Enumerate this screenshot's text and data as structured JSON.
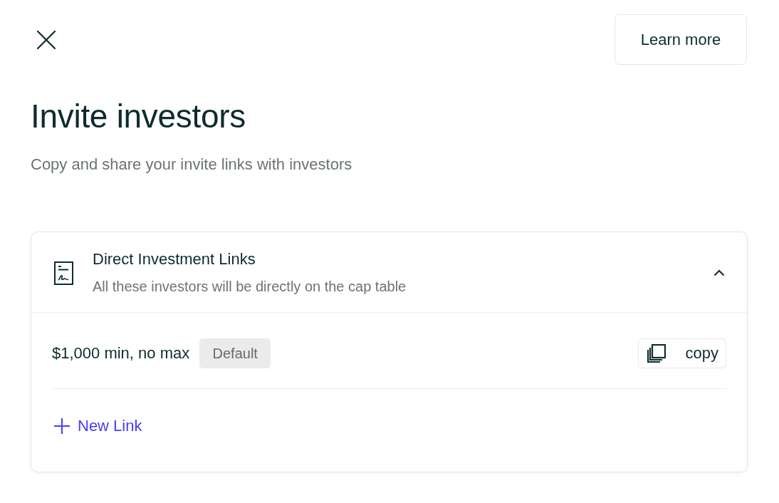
{
  "learn_more_button": "Learn more",
  "title": "Invite investors",
  "subtitle": "Copy and share your invite links with investors",
  "section": {
    "title": "Direct Investment Links",
    "description": "All these investors will be directly on the cap table",
    "expanded": true,
    "links": [
      {
        "label": "$1,000 min, no max",
        "badge": "Default",
        "copy_button": "copy"
      }
    ],
    "new_link_button": "New Link"
  }
}
